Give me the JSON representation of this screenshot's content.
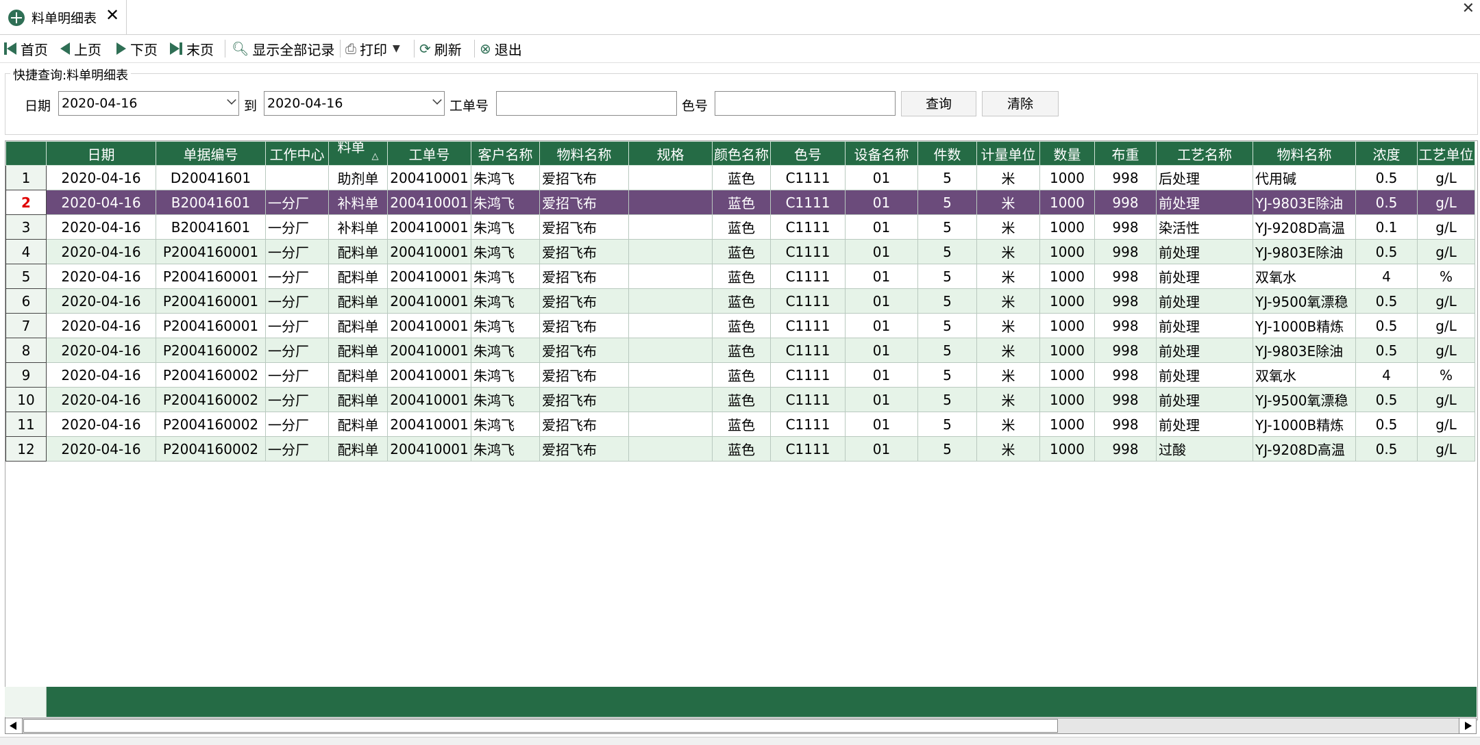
{
  "tab": {
    "title": "料单明细表",
    "close": "✕"
  },
  "window": {
    "close": "✕"
  },
  "toolbar": {
    "first": "首页",
    "prev": "上页",
    "next": "下页",
    "last": "末页",
    "show_all": "显示全部记录",
    "print": "打印",
    "refresh": "刷新",
    "exit": "退出"
  },
  "query": {
    "title": "快捷查询:料单明细表",
    "date_label": "日期",
    "date_from": "2020-04-16",
    "to_label": "到",
    "date_to": "2020-04-16",
    "order_label": "工单号",
    "order_value": "",
    "color_label": "色号",
    "color_value": "",
    "search_btn": "查询",
    "clear_btn": "清除"
  },
  "grid": {
    "columns": [
      "日期",
      "单据编号",
      "工作中心",
      "料单",
      "工单号",
      "客户名称",
      "物料名称",
      "规格",
      "颜色名称",
      "色号",
      "设备名称",
      "件数",
      "计量单位",
      "数量",
      "布重",
      "工艺名称",
      "物料名称",
      "浓度",
      "工艺单位"
    ],
    "sort_indicator": "△",
    "selected_row": 2,
    "rows": [
      [
        "1",
        "2020-04-16",
        "D20041601",
        "",
        "助剂单",
        "200410001",
        "朱鸿飞",
        "爱招飞布",
        "",
        "蓝色",
        "C1111",
        "01",
        "5",
        "米",
        "1000",
        "998",
        "后处理",
        "代用碱",
        "0.5",
        "g/L"
      ],
      [
        "2",
        "2020-04-16",
        "B20041601",
        "一分厂",
        "补料单",
        "200410001",
        "朱鸿飞",
        "爱招飞布",
        "",
        "蓝色",
        "C1111",
        "01",
        "5",
        "米",
        "1000",
        "998",
        "前处理",
        "YJ-9803E除油",
        "0.5",
        "g/L"
      ],
      [
        "3",
        "2020-04-16",
        "B20041601",
        "一分厂",
        "补料单",
        "200410001",
        "朱鸿飞",
        "爱招飞布",
        "",
        "蓝色",
        "C1111",
        "01",
        "5",
        "米",
        "1000",
        "998",
        "染活性",
        "YJ-9208D高温",
        "0.1",
        "g/L"
      ],
      [
        "4",
        "2020-04-16",
        "P2004160001",
        "一分厂",
        "配料单",
        "200410001",
        "朱鸿飞",
        "爱招飞布",
        "",
        "蓝色",
        "C1111",
        "01",
        "5",
        "米",
        "1000",
        "998",
        "前处理",
        "YJ-9803E除油",
        "0.5",
        "g/L"
      ],
      [
        "5",
        "2020-04-16",
        "P2004160001",
        "一分厂",
        "配料单",
        "200410001",
        "朱鸿飞",
        "爱招飞布",
        "",
        "蓝色",
        "C1111",
        "01",
        "5",
        "米",
        "1000",
        "998",
        "前处理",
        "双氧水",
        "4",
        "%"
      ],
      [
        "6",
        "2020-04-16",
        "P2004160001",
        "一分厂",
        "配料单",
        "200410001",
        "朱鸿飞",
        "爱招飞布",
        "",
        "蓝色",
        "C1111",
        "01",
        "5",
        "米",
        "1000",
        "998",
        "前处理",
        "YJ-9500氧漂稳",
        "0.5",
        "g/L"
      ],
      [
        "7",
        "2020-04-16",
        "P2004160001",
        "一分厂",
        "配料单",
        "200410001",
        "朱鸿飞",
        "爱招飞布",
        "",
        "蓝色",
        "C1111",
        "01",
        "5",
        "米",
        "1000",
        "998",
        "前处理",
        "YJ-1000B精炼",
        "0.5",
        "g/L"
      ],
      [
        "8",
        "2020-04-16",
        "P2004160002",
        "一分厂",
        "配料单",
        "200410001",
        "朱鸿飞",
        "爱招飞布",
        "",
        "蓝色",
        "C1111",
        "01",
        "5",
        "米",
        "1000",
        "998",
        "前处理",
        "YJ-9803E除油",
        "0.5",
        "g/L"
      ],
      [
        "9",
        "2020-04-16",
        "P2004160002",
        "一分厂",
        "配料单",
        "200410001",
        "朱鸿飞",
        "爱招飞布",
        "",
        "蓝色",
        "C1111",
        "01",
        "5",
        "米",
        "1000",
        "998",
        "前处理",
        "双氧水",
        "4",
        "%"
      ],
      [
        "10",
        "2020-04-16",
        "P2004160002",
        "一分厂",
        "配料单",
        "200410001",
        "朱鸿飞",
        "爱招飞布",
        "",
        "蓝色",
        "C1111",
        "01",
        "5",
        "米",
        "1000",
        "998",
        "前处理",
        "YJ-9500氧漂稳",
        "0.5",
        "g/L"
      ],
      [
        "11",
        "2020-04-16",
        "P2004160002",
        "一分厂",
        "配料单",
        "200410001",
        "朱鸿飞",
        "爱招飞布",
        "",
        "蓝色",
        "C1111",
        "01",
        "5",
        "米",
        "1000",
        "998",
        "前处理",
        "YJ-1000B精炼",
        "0.5",
        "g/L"
      ],
      [
        "12",
        "2020-04-16",
        "P2004160002",
        "一分厂",
        "配料单",
        "200410001",
        "朱鸿飞",
        "爱招飞布",
        "",
        "蓝色",
        "C1111",
        "01",
        "5",
        "米",
        "1000",
        "998",
        "过酸",
        "YJ-9208D高温",
        "0.5",
        "g/L"
      ]
    ]
  },
  "colors": {
    "header": "#256b45",
    "selected": "#6b4b7b",
    "odd_row": "#e6f3e8",
    "icon": "#2f6f55"
  }
}
